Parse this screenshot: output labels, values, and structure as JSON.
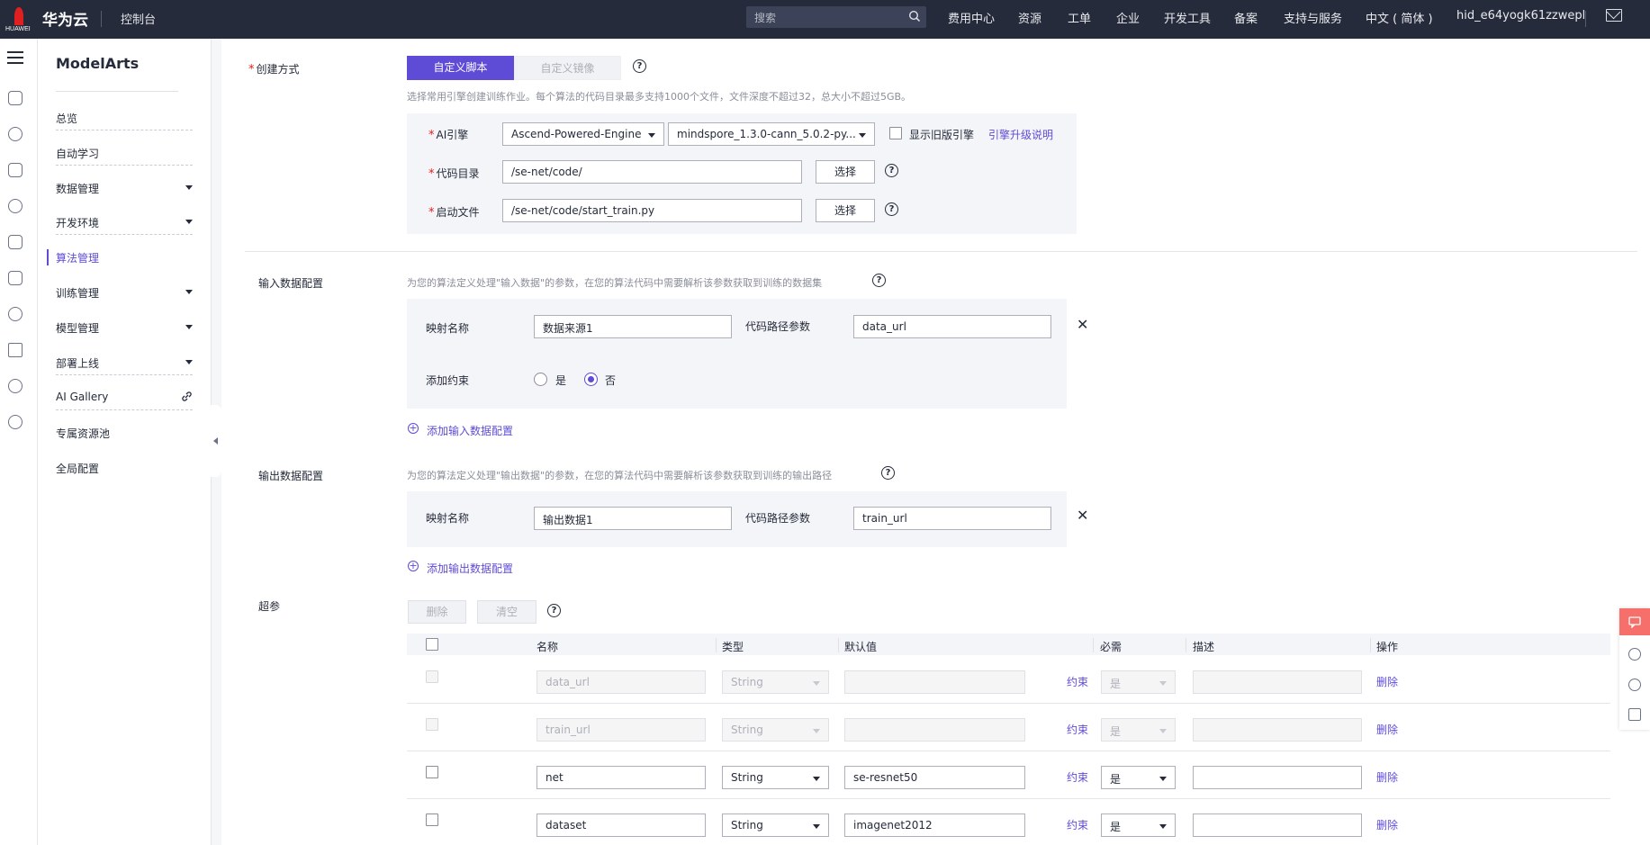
{
  "topbar": {
    "logo_text": "HUAWEI",
    "brand": "华为云",
    "console": "控制台",
    "search_placeholder": "搜索",
    "nav": [
      "费用中心",
      "资源",
      "工单",
      "企业",
      "开发工具",
      "备案",
      "支持与服务",
      "中文 ( 简体 )",
      "hid_e64yogk61zzwepl"
    ]
  },
  "sidebar": {
    "title": "ModelArts",
    "items": [
      {
        "label": "总览",
        "has_caret": false
      },
      {
        "label": "自动学习",
        "has_caret": false
      },
      {
        "label": "数据管理",
        "has_caret": true
      },
      {
        "label": "开发环境",
        "has_caret": true
      },
      {
        "label": "算法管理",
        "has_caret": false,
        "active": true
      },
      {
        "label": "训练管理",
        "has_caret": true
      },
      {
        "label": "模型管理",
        "has_caret": true
      },
      {
        "label": "部署上线",
        "has_caret": true
      },
      {
        "label": "AI Gallery",
        "has_caret": false
      },
      {
        "label": "专属资源池",
        "has_caret": false
      },
      {
        "label": "全局配置",
        "has_caret": false
      }
    ]
  },
  "create_mode": {
    "label": "创建方式",
    "tabs": [
      "自定义脚本",
      "自定义镜像"
    ],
    "hint": "选择常用引擎创建训练作业。每个算法的代码目录最多支持1000个文件，文件深度不超过32，总大小不超过5GB。",
    "ai_engine_label": "AI引擎",
    "engine": "Ascend-Powered-Engine",
    "engine_version": "mindspore_1.3.0-cann_5.0.2-py...",
    "show_old_label": "显示旧版引擎",
    "upgrade_link": "引擎升级说明",
    "code_dir_label": "代码目录",
    "code_dir_value": "/se-net/code/",
    "boot_file_label": "启动文件",
    "boot_file_value": "/se-net/code/start_train.py",
    "select_btn": "选择"
  },
  "input_config": {
    "label": "输入数据配置",
    "hint": "为您的算法定义处理\"输入数据\"的参数，在您的算法代码中需要解析该参数获取到训练的数据集",
    "map_name_label": "映射名称",
    "map_name_value": "数据来源1",
    "code_param_label": "代码路径参数",
    "code_param_value": "data_url",
    "constraint_label": "添加约束",
    "radio_yes": "是",
    "radio_no": "否",
    "add_link": "添加输入数据配置"
  },
  "output_config": {
    "label": "输出数据配置",
    "hint": "为您的算法定义处理\"输出数据\"的参数，在您的算法代码中需要解析该参数获取到训练的输出路径",
    "map_name_label": "映射名称",
    "map_name_value": "输出数据1",
    "code_param_label": "代码路径参数",
    "code_param_value": "train_url",
    "add_link": "添加输出数据配置"
  },
  "hyperparams": {
    "label": "超参",
    "delete_btn": "删除",
    "clear_btn": "清空",
    "columns": [
      "名称",
      "类型",
      "默认值",
      "必需",
      "描述",
      "操作"
    ],
    "constraint_link": "约束",
    "delete_link": "删除",
    "rows": [
      {
        "name": "data_url",
        "type": "String",
        "default": "",
        "required": "是",
        "desc": "",
        "disabled": true
      },
      {
        "name": "train_url",
        "type": "String",
        "default": "",
        "required": "是",
        "desc": "",
        "disabled": true
      },
      {
        "name": "net",
        "type": "String",
        "default": "se-resnet50",
        "required": "是",
        "desc": "",
        "disabled": false
      },
      {
        "name": "dataset",
        "type": "String",
        "default": "imagenet2012",
        "required": "是",
        "desc": "",
        "disabled": false
      }
    ]
  },
  "colors": {
    "accent": "#5e4cd6",
    "topbar": "#252b3a",
    "required": "#e02020"
  }
}
